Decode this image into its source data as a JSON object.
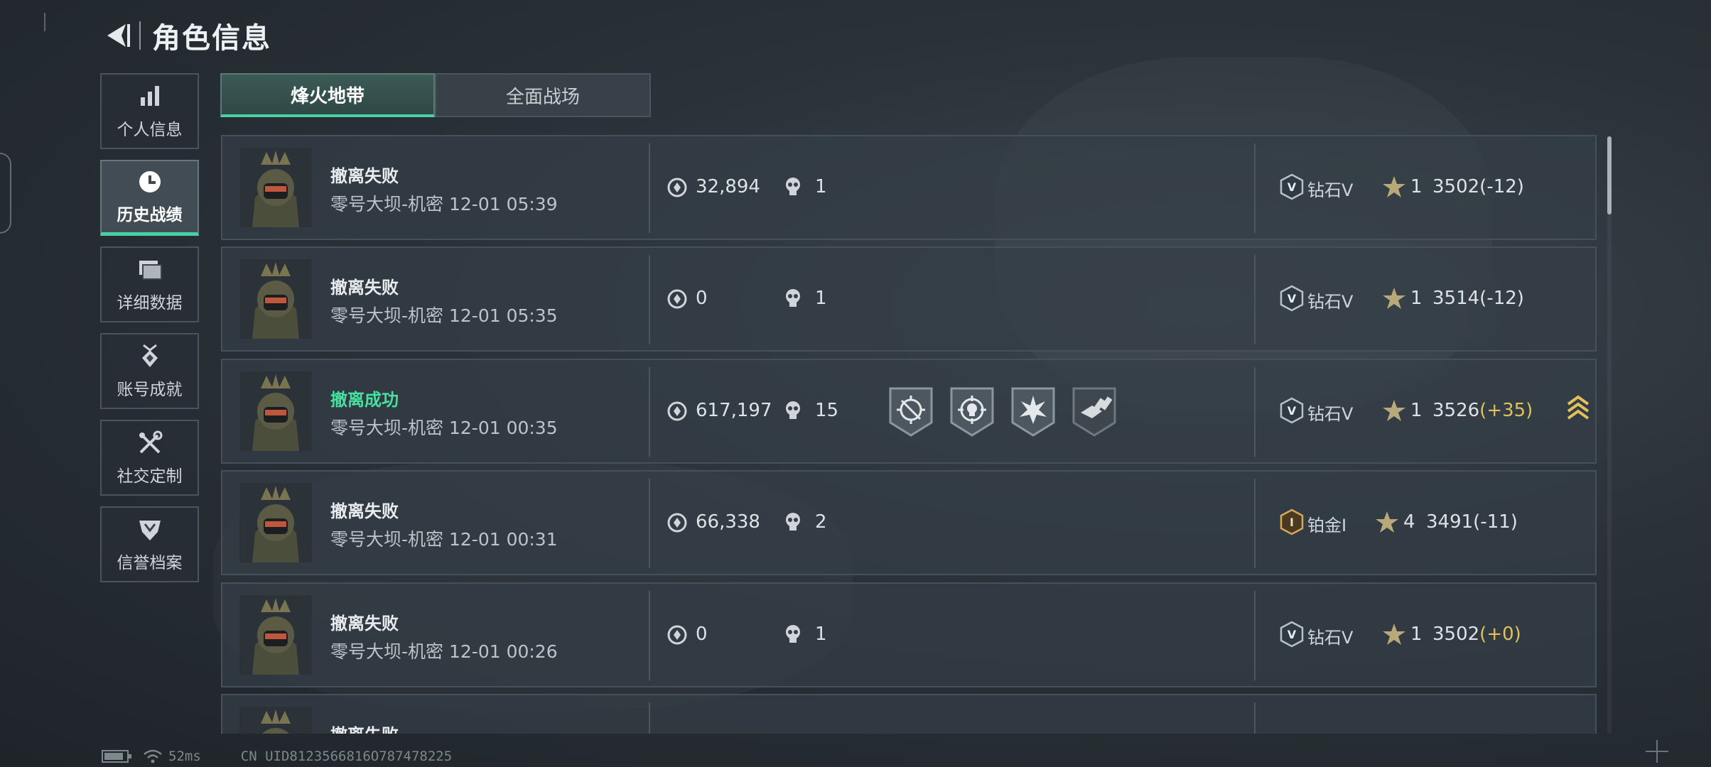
{
  "header": {
    "title": "角色信息"
  },
  "sidebar": {
    "items": [
      {
        "label": "个人信息",
        "icon": "bar-chart-icon",
        "active": false
      },
      {
        "label": "历史战绩",
        "icon": "clock-icon",
        "active": true
      },
      {
        "label": "详细数据",
        "icon": "folder-icon",
        "active": false
      },
      {
        "label": "账号成就",
        "icon": "medal-icon",
        "active": false
      },
      {
        "label": "社交定制",
        "icon": "tools-icon",
        "active": false
      },
      {
        "label": "信誉档案",
        "icon": "shield-icon",
        "active": false
      }
    ]
  },
  "tabs": [
    {
      "label": "烽火地带",
      "active": true
    },
    {
      "label": "全面战场",
      "active": false
    }
  ],
  "records": [
    {
      "result": "撤离失败",
      "success": false,
      "map": "零号大坝-机密",
      "time": "12-01 05:39",
      "money": "32,894",
      "kills": "1",
      "rank_name": "钻石V",
      "rank_icon": "rank-diamond-icon",
      "stars": "1",
      "score": "3502",
      "delta": "(-12)",
      "delta_positive": false
    },
    {
      "result": "撤离失败",
      "success": false,
      "map": "零号大坝-机密",
      "time": "12-01 05:35",
      "money": "0",
      "kills": "1",
      "rank_name": "钻石V",
      "rank_icon": "rank-diamond-icon",
      "stars": "1",
      "score": "3514",
      "delta": "(-12)",
      "delta_positive": false
    },
    {
      "result": "撤离成功",
      "success": true,
      "map": "零号大坝-机密",
      "time": "12-01 00:35",
      "money": "617,197",
      "kills": "15",
      "rank_name": "钻石V",
      "rank_icon": "rank-diamond-icon",
      "stars": "1",
      "score": "3526",
      "delta": "(+35)",
      "delta_positive": true,
      "badges": [
        "crosshair-rotate-badge",
        "target-skull-badge",
        "explosion-badge",
        "ammo-hand-badge"
      ],
      "rank_up": true
    },
    {
      "result": "撤离失败",
      "success": false,
      "map": "零号大坝-机密",
      "time": "12-01 00:31",
      "money": "66,338",
      "kills": "2",
      "rank_name": "铂金I",
      "rank_icon": "rank-platinum-icon",
      "stars": "4",
      "score": "3491",
      "delta": "(-11)",
      "delta_positive": false
    },
    {
      "result": "撤离失败",
      "success": false,
      "map": "零号大坝-机密",
      "time": "12-01 00:26",
      "money": "0",
      "kills": "1",
      "rank_name": "钻石V",
      "rank_icon": "rank-diamond-icon",
      "stars": "1",
      "score": "3502",
      "delta": "(+0)",
      "delta_positive": true
    },
    {
      "result": "撤离失败",
      "success": false,
      "map": "",
      "time": "",
      "money": "",
      "kills": "",
      "rank_name": "",
      "stars": "",
      "score": "",
      "delta": ""
    }
  ],
  "status_bar": {
    "ping": "52ms",
    "uid": "CN UID8123566816O787478225"
  },
  "colors": {
    "accent": "#46d2a5",
    "success": "#46e0a0",
    "gold": "#e0c15a",
    "panel": "#343e46"
  }
}
